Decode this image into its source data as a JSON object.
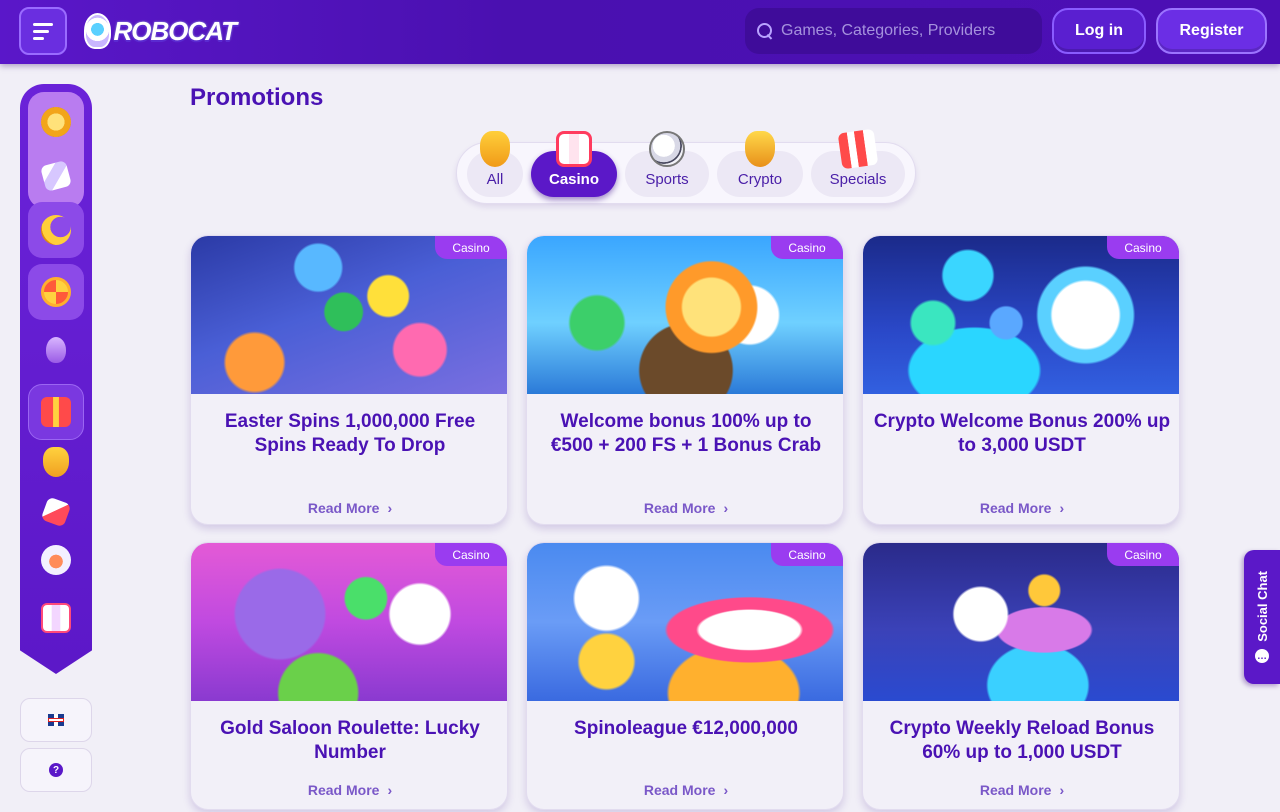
{
  "header": {
    "logo": "ROBOCAT",
    "search_placeholder": "Games, Categories, Providers",
    "login_label": "Log in",
    "register_label": "Register"
  },
  "sidebar": {
    "items": [
      {
        "icon": "coin-icon"
      },
      {
        "icon": "slot-reel-icon"
      },
      {
        "icon": "crescent-coin-icon"
      },
      {
        "icon": "wheel-icon"
      },
      {
        "icon": "egg-icon"
      },
      {
        "icon": "gift-icon"
      },
      {
        "icon": "trophy-icon"
      },
      {
        "icon": "dice-icon"
      },
      {
        "icon": "cat-head-icon"
      },
      {
        "icon": "slot-777-icon"
      }
    ],
    "language_icon": "uk-flag-icon",
    "help_label": "?"
  },
  "page_title": "Promotions",
  "tabs": [
    {
      "label": "All",
      "icon": "trophy-icon"
    },
    {
      "label": "Casino",
      "icon": "slot-machine-icon",
      "active": true
    },
    {
      "label": "Sports",
      "icon": "soccer-ball-icon"
    },
    {
      "label": "Crypto",
      "icon": "gold-cup-icon"
    },
    {
      "label": "Specials",
      "icon": "gift-box-icon"
    }
  ],
  "cards": [
    {
      "badge": "Casino",
      "title": "Easter Spins 1,000,000 Free Spins Ready To Drop",
      "read_more": "Read More",
      "chevron": "›"
    },
    {
      "badge": "Casino",
      "title": "Welcome bonus 100% up to €500 + 200 FS + 1 Bonus Crab",
      "read_more": "Read More",
      "chevron": "›"
    },
    {
      "badge": "Casino",
      "title": "Crypto Welcome Bonus 200% up to 3,000 USDT",
      "read_more": "Read More",
      "chevron": "›"
    },
    {
      "badge": "Casino",
      "title": "Gold Saloon Roulette: Lucky Number",
      "read_more": "Read More",
      "chevron": "›"
    },
    {
      "badge": "Casino",
      "title": "Spinoleague €12,000,000",
      "read_more": "Read More",
      "chevron": "›"
    },
    {
      "badge": "Casino",
      "title": "Crypto Weekly Reload Bonus 60% up to 1,000 USDT",
      "read_more": "Read More",
      "chevron": "›"
    }
  ],
  "social_chat_label": "Social Chat",
  "colors": {
    "brand_purple": "#5b18c8",
    "badge_purple": "#9a3cf0",
    "title_purple": "#4a12b4",
    "page_bg": "#f1eff7"
  }
}
